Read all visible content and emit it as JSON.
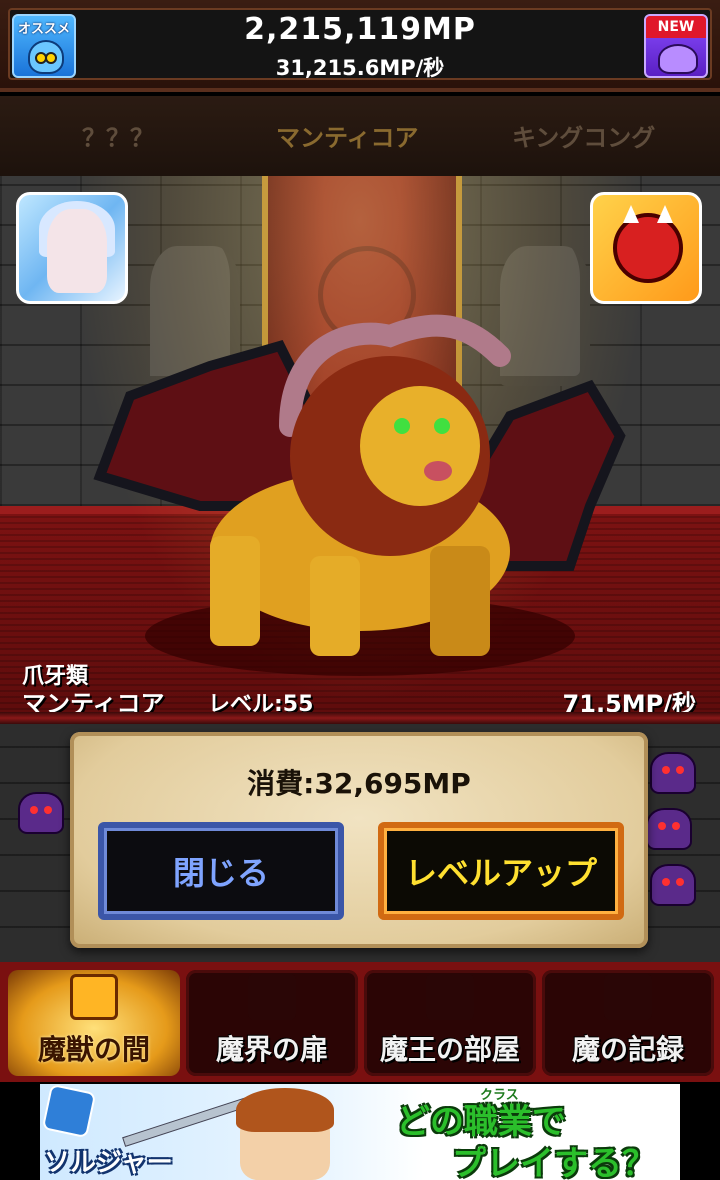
{
  "header": {
    "mp_total": "2,215,119MP",
    "mp_rate": "31,215.6MP/秒",
    "recommend_label": "オススメ",
    "new_label": "NEW"
  },
  "selector": {
    "prev": "？？？",
    "current": "マンティコア",
    "next": "キングコング"
  },
  "monster": {
    "type": "爪牙類",
    "name": "マンティコア",
    "level": "レベル:55",
    "rate": "71.5MP/秒"
  },
  "dialog": {
    "cost": "消費:32,695MP",
    "close_label": "閉じる",
    "levelup_label": "レベルアップ"
  },
  "nav": {
    "items": [
      {
        "label": "魔獣の間",
        "active": true
      },
      {
        "label": "魔界の扉",
        "active": false
      },
      {
        "label": "魔王の部屋",
        "active": false
      },
      {
        "label": "魔の記録",
        "active": false
      }
    ]
  },
  "ad": {
    "brand": "ソルジャー",
    "ruby": "クラス",
    "line1": "どの職業で",
    "line2": "プレイする？"
  },
  "colors": {
    "accent_gold": "#ffe030",
    "close_blue": "#7fa4ff",
    "stage_red": "#7c1212"
  }
}
